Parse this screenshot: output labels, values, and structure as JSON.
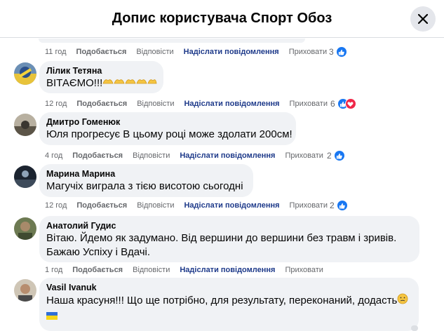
{
  "header": {
    "title": "Допис користувача Спорт Обоз",
    "close_icon": "close-icon"
  },
  "first_actions": {
    "time": "11 год",
    "like": "Подобається",
    "reply": "Відповісти",
    "send": "Надіслати повідомлення",
    "hide": "Приховати",
    "count": "3"
  },
  "comments": [
    {
      "author": "Лілик Тетяна",
      "text": "ВІТАЄМО!!!",
      "time": "12 год",
      "like": "Подобається",
      "reply": "Відповісти",
      "send": "Надіслати повідомлення",
      "hide": "Приховати",
      "count": "6"
    },
    {
      "author": "Дмитро Гоменюк",
      "text": "Юля прогресує В цьому році може здолати 200см!",
      "time": "4 год",
      "like": "Подобається",
      "reply": "Відповісти",
      "send": "Надіслати повідомлення",
      "hide": "Приховати",
      "count": "2"
    },
    {
      "author": "Марина Марина",
      "text": "Магучіх виграла з тією висотою сьогодні",
      "time": "12 год",
      "like": "Подобається",
      "reply": "Відповісти",
      "send": "Надіслати повідомлення",
      "hide": "Приховати",
      "count": "2"
    },
    {
      "author": "Анатолий Гудис",
      "text_line1": "Вітаю. Йдемо як задумано. Від вершини до вершини без травм і зривів.",
      "text_line2": "Бажаю Успіху і Вдачі.",
      "time": "1 год",
      "like": "Подобається",
      "reply": "Відповісти",
      "send": "Надіслати повідомлення",
      "hide": "Приховати"
    },
    {
      "author": "Vasil Ivanuk",
      "text": "Наша красуня!!! Що ще потрібно, для результату, переконаний, додасть"
    }
  ],
  "colors": {
    "like": "#1877f2",
    "love": "#f02849",
    "bubble": "#f0f2f5",
    "send_link": "#1e3a8a"
  }
}
